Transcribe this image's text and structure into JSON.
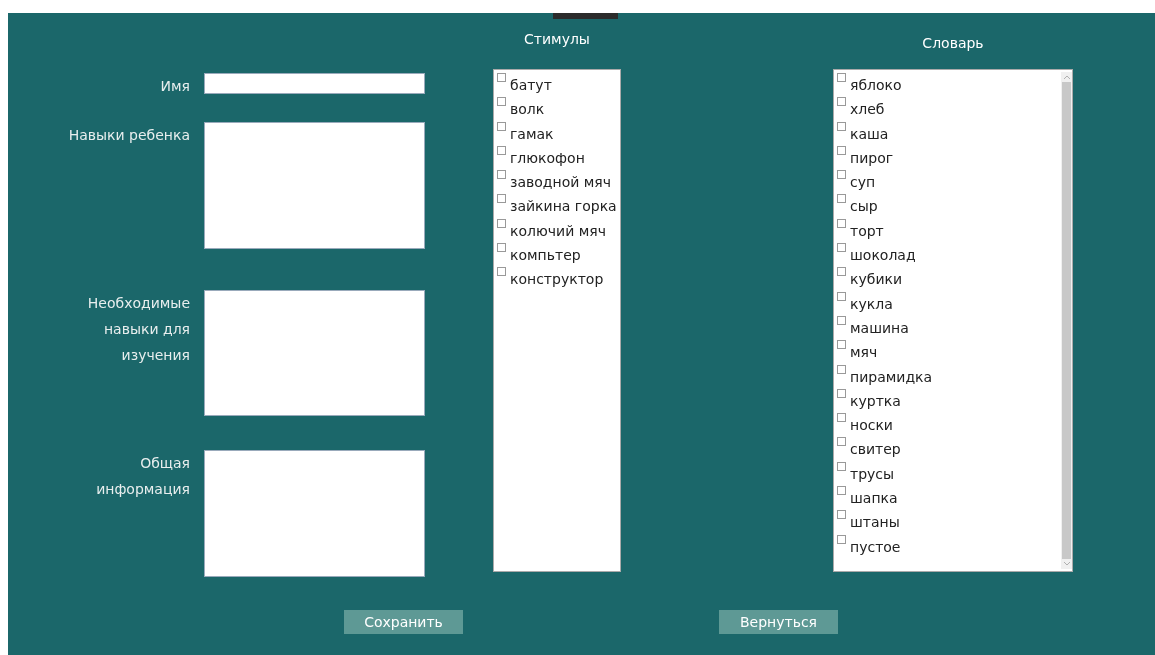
{
  "fields": [
    {
      "label": "Имя",
      "kind": "line"
    },
    {
      "label": "Навыки ребенка",
      "kind": "area"
    },
    {
      "label": "Необходимые навыки для изучения",
      "kind": "area"
    },
    {
      "label": "Общая информация",
      "kind": "area"
    }
  ],
  "stimuli": {
    "title": "Стимулы",
    "items": [
      {
        "label": "батут",
        "checked": false
      },
      {
        "label": "волк",
        "checked": false
      },
      {
        "label": "гамак",
        "checked": false
      },
      {
        "label": "глюкофон",
        "checked": false
      },
      {
        "label": "заводной мяч",
        "checked": false
      },
      {
        "label": "зайкина горка",
        "checked": false
      },
      {
        "label": "колючий мяч",
        "checked": false
      },
      {
        "label": "компьтер",
        "checked": false
      },
      {
        "label": "конструктор",
        "checked": false
      }
    ]
  },
  "dictionary": {
    "title": "Словарь",
    "items": [
      {
        "label": "яблоко",
        "checked": false
      },
      {
        "label": "хлеб",
        "checked": false
      },
      {
        "label": "каша",
        "checked": false
      },
      {
        "label": "пирог",
        "checked": false
      },
      {
        "label": "суп",
        "checked": false
      },
      {
        "label": "сыр",
        "checked": false
      },
      {
        "label": "торт",
        "checked": false
      },
      {
        "label": "шоколад",
        "checked": false
      },
      {
        "label": "кубики",
        "checked": false
      },
      {
        "label": "кукла",
        "checked": false
      },
      {
        "label": "машина",
        "checked": false
      },
      {
        "label": "мяч",
        "checked": false
      },
      {
        "label": "пирамидка",
        "checked": false
      },
      {
        "label": "куртка",
        "checked": false
      },
      {
        "label": "носки",
        "checked": false
      },
      {
        "label": "свитер",
        "checked": false
      },
      {
        "label": "трусы",
        "checked": false
      },
      {
        "label": "шапка",
        "checked": false
      },
      {
        "label": "штаны",
        "checked": false
      },
      {
        "label": "пустое",
        "checked": false
      }
    ]
  },
  "buttons": [
    "Сохранить",
    "Вернуться"
  ]
}
